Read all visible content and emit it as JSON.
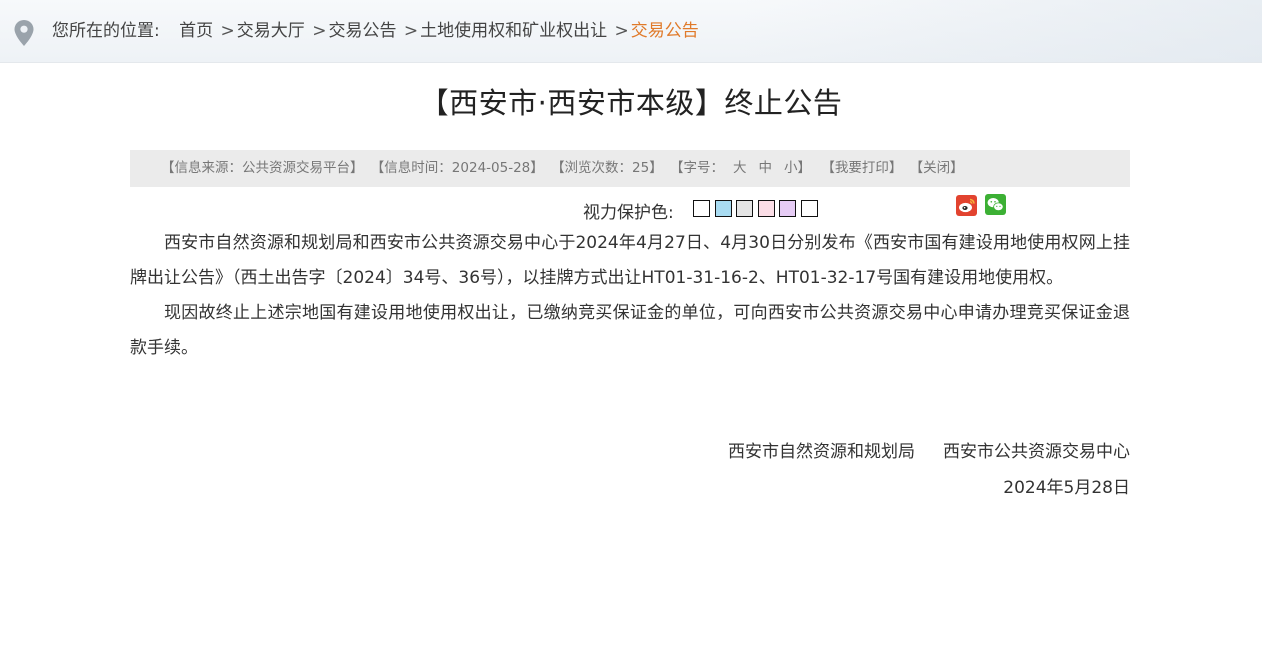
{
  "breadcrumb": {
    "lead": "您所在的位置:",
    "items": [
      "首页",
      "交易大厅",
      "交易公告",
      "土地使用权和矿业权出让",
      "交易公告"
    ],
    "separator": ">"
  },
  "article": {
    "title": "【西安市·西安市本级】终止公告"
  },
  "infobar": {
    "source": "【信息来源：公共资源交易平台】",
    "time": "【信息时间：2024-05-28】",
    "views": "【浏览次数：25】",
    "font_label": "【字号：",
    "font_large": "大",
    "font_medium": "中",
    "font_small": "小】",
    "print": "【我要打印】",
    "close": "【关闭】"
  },
  "eye_care": {
    "label": "视力保护色:",
    "colors": [
      "#ffffff",
      "#a9dcf2",
      "#e5e5e5",
      "#fbdde6",
      "#e6ccf5",
      "#ffffff"
    ]
  },
  "share": {
    "icons": [
      "weibo-icon",
      "wechat-icon"
    ]
  },
  "body": {
    "p1": "西安市自然资源和规划局和西安市公共资源交易中心于2024年4月27日、4月30日分别发布《西安市国有建设用地使用权网上挂牌出让公告》（西土出告字〔2024〕34号、36号），以挂牌方式出让HT01-31-16-2、HT01-32-17号国有建设用地使用权。",
    "p2": "现因故终止上述宗地国有建设用地使用权出让，已缴纳竞买保证金的单位，可向西安市公共资源交易中心申请办理竞买保证金退款手续。"
  },
  "signature": {
    "org1": "西安市自然资源和规划局",
    "org2": "西安市公共资源交易中心",
    "date": "2024年5月28日"
  },
  "colors": {
    "accent": "#e07a2a",
    "infobar_bg": "#ebebeb"
  }
}
